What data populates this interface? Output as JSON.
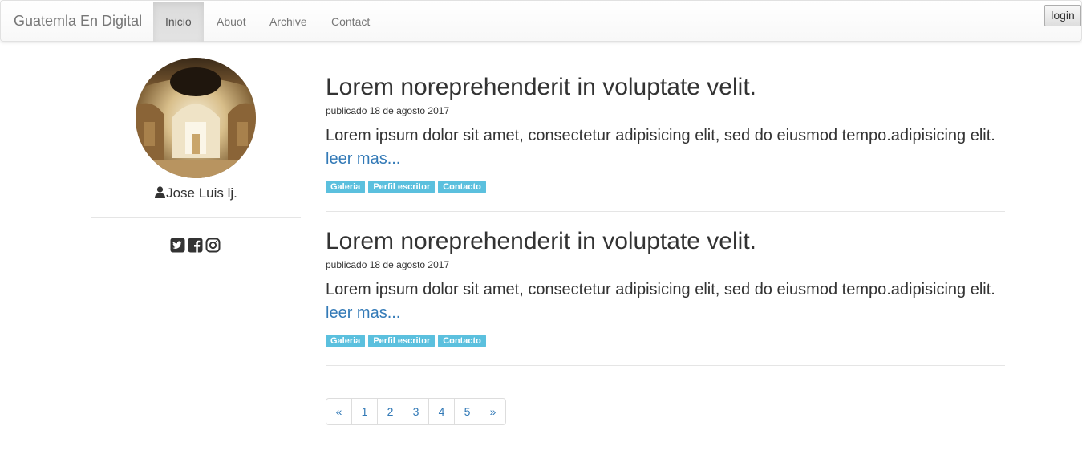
{
  "navbar": {
    "brand": "Guatemla En Digital",
    "items": [
      {
        "label": "Inicio",
        "active": true
      },
      {
        "label": "Abuot",
        "active": false
      },
      {
        "label": "Archive",
        "active": false
      },
      {
        "label": "Contact",
        "active": false
      }
    ],
    "login_label": "login"
  },
  "sidebar": {
    "author_name": "Jose Luis lj.",
    "author_icon": "user-icon",
    "social_icons": [
      "twitter-icon",
      "facebook-icon",
      "instagram-icon"
    ]
  },
  "posts": [
    {
      "title": "Lorem noreprehenderit in voluptate velit.",
      "date": "publicado 18 de agosto 2017",
      "body": "Lorem ipsum dolor sit amet, consectetur adipisicing elit, sed do eiusmod tempo.adipisicing elit.",
      "read_more": "leer mas...",
      "tags": [
        "Galeria",
        "Perfil escritor",
        "Contacto"
      ]
    },
    {
      "title": "Lorem noreprehenderit in voluptate velit.",
      "date": "publicado 18 de agosto 2017",
      "body": "Lorem ipsum dolor sit amet, consectetur adipisicing elit, sed do eiusmod tempo.adipisicing elit.",
      "read_more": "leer mas...",
      "tags": [
        "Galeria",
        "Perfil escritor",
        "Contacto"
      ]
    }
  ],
  "pagination": [
    "«",
    "1",
    "2",
    "3",
    "4",
    "5",
    "»"
  ],
  "colors": {
    "link": "#337ab7",
    "tag": "#5bc0de",
    "text": "#333333"
  }
}
